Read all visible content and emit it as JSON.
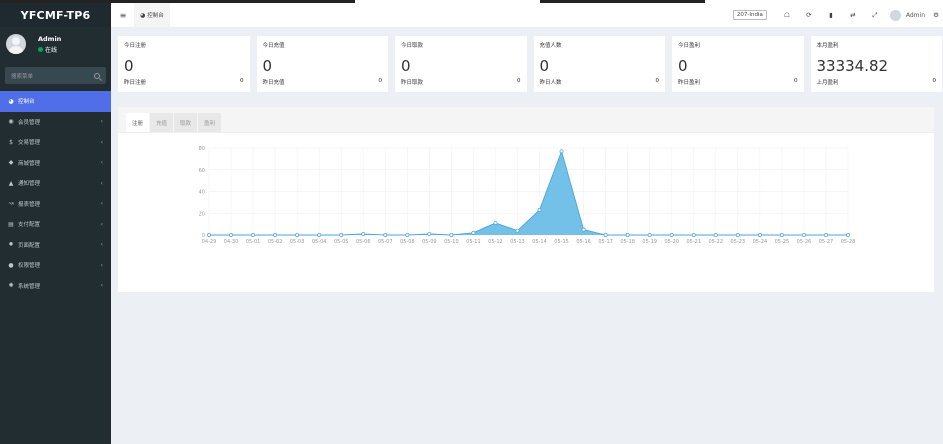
{
  "app": {
    "logo": "YFCMF-TP6"
  },
  "user": {
    "name": "Admin",
    "status": "在线"
  },
  "sidebar": {
    "search_placeholder": "搜索菜单",
    "items": [
      {
        "label": "控制台",
        "icon": "dashboard-icon",
        "active": true,
        "has_children": false
      },
      {
        "label": "会员管理",
        "icon": "user-circle-icon",
        "active": false,
        "has_children": true
      },
      {
        "label": "交易管理",
        "icon": "dollar-icon",
        "active": false,
        "has_children": true
      },
      {
        "label": "商城管理",
        "icon": "tag-icon",
        "active": false,
        "has_children": true
      },
      {
        "label": "通知管理",
        "icon": "bell-icon",
        "active": false,
        "has_children": true
      },
      {
        "label": "报表管理",
        "icon": "line-chart-icon",
        "active": false,
        "has_children": true
      },
      {
        "label": "支付配置",
        "icon": "credit-card-icon",
        "active": false,
        "has_children": true
      },
      {
        "label": "页面配置",
        "icon": "cog-icon",
        "active": false,
        "has_children": true
      },
      {
        "label": "权限管理",
        "icon": "users-icon",
        "active": false,
        "has_children": true
      },
      {
        "label": "系统管理",
        "icon": "cogs-icon",
        "active": false,
        "has_children": true
      }
    ]
  },
  "navbar": {
    "tab_label": "控制台",
    "env_badge": "207-India",
    "user_name": "Admin",
    "icons": [
      "home-icon",
      "refresh-icon",
      "trash-icon",
      "translate-icon",
      "fullscreen-icon"
    ]
  },
  "stats": [
    {
      "title": "今日注册",
      "value": "0",
      "sub_label": "昨日注册",
      "sub_value": "0"
    },
    {
      "title": "今日充值",
      "value": "0",
      "sub_label": "昨日充值",
      "sub_value": "0"
    },
    {
      "title": "今日取款",
      "value": "0",
      "sub_label": "昨日取款",
      "sub_value": "0"
    },
    {
      "title": "充值人数",
      "value": "0",
      "sub_label": "昨日人数",
      "sub_value": "0"
    },
    {
      "title": "今日盈利",
      "value": "0",
      "sub_label": "昨日盈利",
      "sub_value": "0"
    },
    {
      "title": "本月盈利",
      "value": "33334.82",
      "sub_label": "上月盈利",
      "sub_value": "0"
    }
  ],
  "chart_tabs": [
    {
      "label": "注册",
      "active": true
    },
    {
      "label": "充值",
      "active": false
    },
    {
      "label": "取款",
      "active": false
    },
    {
      "label": "盈利",
      "active": false
    }
  ],
  "colors": {
    "sidebar_bg": "#222d32",
    "active_menu": "#4f6ee8",
    "area_fill": "#5bb5e5",
    "area_line": "#4aa6d8"
  },
  "chart_data": {
    "type": "area",
    "x": [
      "04-29",
      "04-30",
      "05-01",
      "05-02",
      "05-03",
      "05-04",
      "05-05",
      "05-06",
      "05-07",
      "05-08",
      "05-09",
      "05-10",
      "05-11",
      "05-12",
      "05-13",
      "05-14",
      "05-15",
      "05-16",
      "05-17",
      "05-18",
      "05-19",
      "05-20",
      "05-21",
      "05-22",
      "05-23",
      "05-24",
      "05-25",
      "05-26",
      "05-27",
      "05-28"
    ],
    "values": [
      0,
      0,
      0,
      0,
      0,
      0,
      0,
      1,
      0,
      0,
      1,
      0,
      2,
      11,
      4,
      23,
      77,
      5,
      0,
      0,
      0,
      0,
      0,
      0,
      0,
      0,
      0,
      0,
      0,
      0
    ],
    "yticks": [
      0,
      20,
      40,
      60,
      80
    ],
    "ylim": [
      0,
      80
    ],
    "grid": true
  }
}
